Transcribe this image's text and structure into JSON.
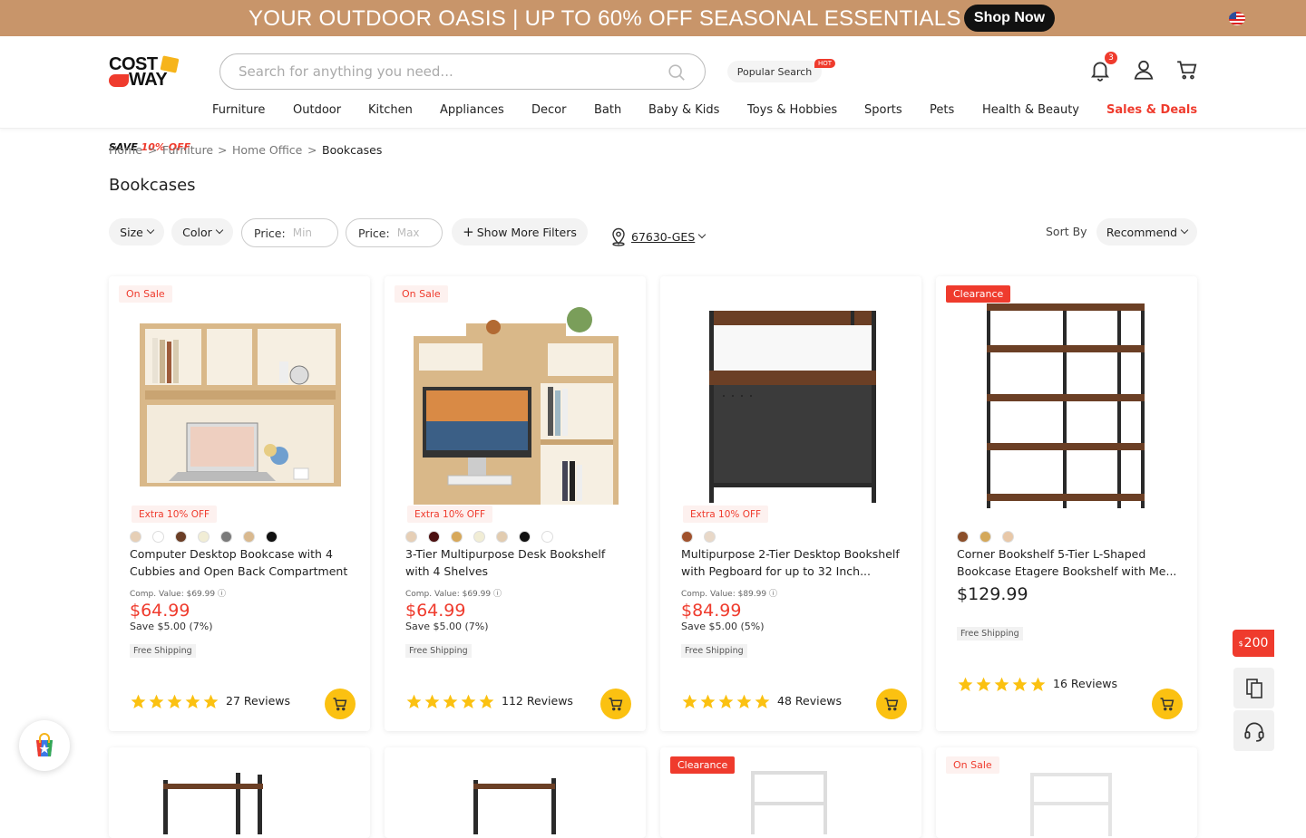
{
  "banner": {
    "text": "YOUR OUTDOOR OASIS  |  UP TO 60% OFF SEASONAL ESSENTIALS",
    "cta": "Shop Now",
    "bg_color": "#c8956a",
    "flag_icon": "us-flag-icon"
  },
  "header": {
    "logo_line1": "COST",
    "logo_line2": "WAY",
    "search_placeholder": "Search for anything you need...",
    "popular_search": "Popular Search",
    "hot_badge": "HOT",
    "notification_count": "3",
    "save_prefix": "SAVE",
    "save_offer": "10% OFF"
  },
  "nav": [
    "Furniture",
    "Outdoor",
    "Kitchen",
    "Appliances",
    "Decor",
    "Bath",
    "Baby & Kids",
    "Toys & Hobbies",
    "Sports",
    "Pets",
    "Health & Beauty",
    "Sales & Deals"
  ],
  "breadcrumb": [
    "Home",
    "Furniture",
    "Home Office",
    "Bookcases"
  ],
  "breadcrumb_sep": ">",
  "page_title": "Bookcases",
  "filters": {
    "size": "Size",
    "color": "Color",
    "price_label": "Price:",
    "min_placeholder": "Min",
    "max_placeholder": "Max",
    "more": "Show More Filters",
    "zip": "67630-GES",
    "sort_label": "Sort By",
    "sort_value": "Recommend"
  },
  "products": [
    {
      "tag": "On Sale",
      "extra": "Extra 10% OFF",
      "swatches": [
        "#e6cfb6",
        "#ffffff",
        "#6b3e26",
        "#f1edd5",
        "#7a7a7a",
        "#d9b98f",
        "#111111"
      ],
      "name": "Computer Desktop Bookcase with 4 Cubbies and Open Back Compartment",
      "comp": "Comp. Value: $69.99",
      "price": "$64.99",
      "save": "Save $5.00 (7%)",
      "shipping": "Free Shipping",
      "rating": 5,
      "reviews": "27 Reviews"
    },
    {
      "tag": "On Sale",
      "extra": "Extra 10% OFF",
      "swatches": [
        "#e6cfb6",
        "#4b0f10",
        "#d7a85a",
        "#f1edd5",
        "#e2ccb0",
        "#111111",
        "#ffffff"
      ],
      "name": "3-Tier Multipurpose Desk Bookshelf with 4 Shelves",
      "comp": "Comp. Value: $69.99",
      "price": "$64.99",
      "save": "Save $5.00 (7%)",
      "shipping": "Free Shipping",
      "rating": 5,
      "reviews": "112 Reviews"
    },
    {
      "tag": "",
      "extra": "Extra 10% OFF",
      "swatches": [
        "#a0522d",
        "#e8d8c8"
      ],
      "name": "Multipurpose 2-Tier Desktop Bookshelf with Pegboard for up to 32 Inch...",
      "comp": "Comp. Value: $89.99",
      "price": "$84.99",
      "save": "Save $5.00 (5%)",
      "shipping": "Free Shipping",
      "rating": 5,
      "reviews": "48 Reviews"
    },
    {
      "tag": "Clearance",
      "extra": "",
      "swatches": [
        "#8b4f2a",
        "#d4a85a",
        "#e8c8a8"
      ],
      "name": "Corner Bookshelf 5-Tier L-Shaped Bookcase Etagere Bookshelf with Me...",
      "comp": "",
      "price": "$129.99",
      "save": "",
      "shipping": "Free Shipping",
      "rating": 5,
      "reviews": "16 Reviews"
    }
  ],
  "row2_tags": [
    "",
    "",
    "Clearance",
    "On Sale"
  ],
  "floating": {
    "coupon_currency": "$",
    "coupon_amount": "200"
  },
  "colors": {
    "accent_red": "#ef3b2d",
    "cart_yellow": "#fbc111",
    "star_yellow": "#fbc111"
  }
}
